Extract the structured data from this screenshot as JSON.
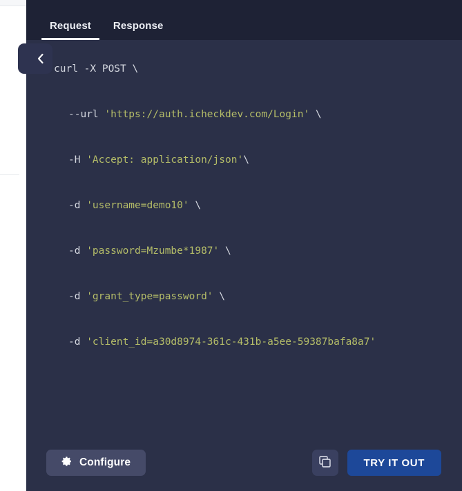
{
  "panel": {
    "tabs": [
      {
        "label": "Request",
        "active": true
      },
      {
        "label": "Response",
        "active": false
      }
    ],
    "collapse_handle_icon": "chevron-left-icon"
  },
  "code": {
    "language": "shell",
    "lines": [
      {
        "indent": 0,
        "tokens": [
          {
            "type": "plain",
            "text": "curl -X POST \\"
          }
        ]
      },
      {
        "indent": 1,
        "tokens": [
          {
            "type": "flag",
            "text": "--url "
          },
          {
            "type": "string",
            "text": "'https://auth.icheckdev.com/Login'"
          },
          {
            "type": "plain",
            "text": " \\"
          }
        ]
      },
      {
        "indent": 1,
        "tokens": [
          {
            "type": "flag",
            "text": "-H "
          },
          {
            "type": "string",
            "text": "'Accept: application/json'"
          },
          {
            "type": "plain",
            "text": "\\"
          }
        ]
      },
      {
        "indent": 1,
        "tokens": [
          {
            "type": "flag",
            "text": "-d "
          },
          {
            "type": "string",
            "text": "'username=demo10'"
          },
          {
            "type": "plain",
            "text": " \\"
          }
        ]
      },
      {
        "indent": 1,
        "tokens": [
          {
            "type": "flag",
            "text": "-d "
          },
          {
            "type": "string",
            "text": "'password=Mzumbe*1987'"
          },
          {
            "type": "plain",
            "text": " \\"
          }
        ]
      },
      {
        "indent": 1,
        "tokens": [
          {
            "type": "flag",
            "text": "-d "
          },
          {
            "type": "string",
            "text": "'grant_type=password'"
          },
          {
            "type": "plain",
            "text": " \\"
          }
        ]
      },
      {
        "indent": 1,
        "tokens": [
          {
            "type": "flag",
            "text": "-d "
          },
          {
            "type": "string",
            "text": "'client_id=a30d8974-361c-431b-a5ee-59387bafa8a7'"
          }
        ]
      }
    ]
  },
  "actions": {
    "configure_label": "Configure",
    "configure_icon": "gear-icon",
    "copy_icon": "copy-icon",
    "try_it_out_label": "TRY IT OUT"
  },
  "colors": {
    "panel_body": "#2b3048",
    "tab_bar": "#1e2235",
    "accent_blue": "#1d4899",
    "code_string": "#b5bd68",
    "code_plain": "#d5d8e0",
    "configure_bg": "#454a68",
    "scrollbar_thumb": "#ced3e2"
  }
}
